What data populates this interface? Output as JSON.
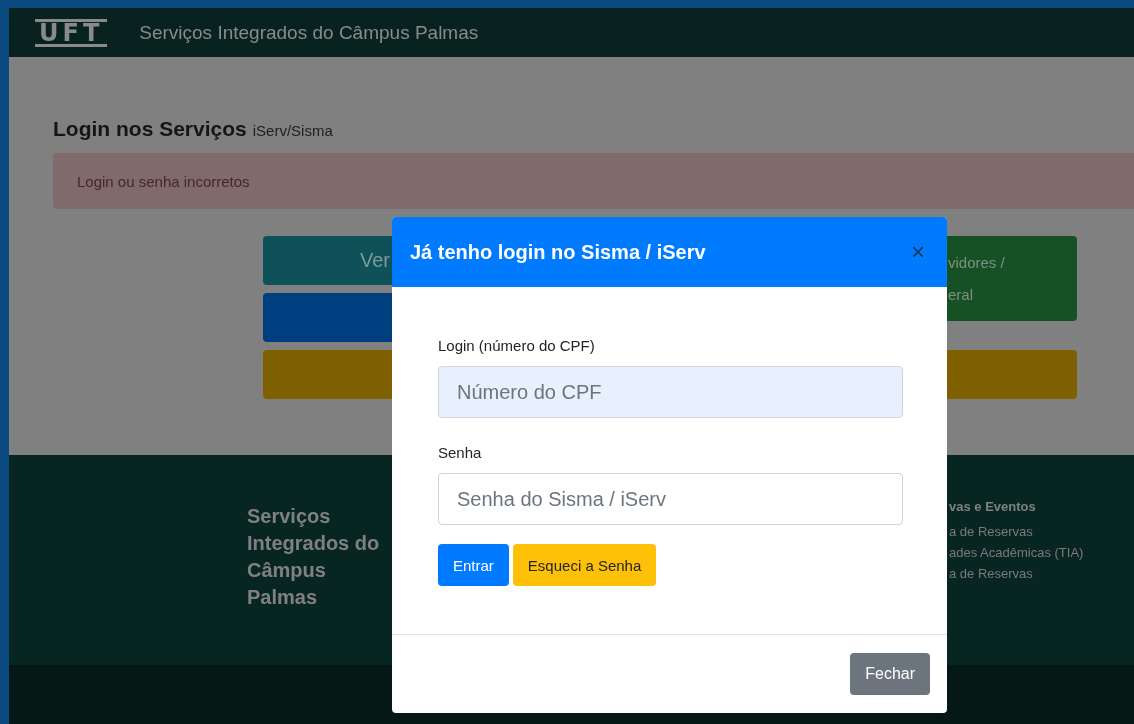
{
  "header": {
    "logo": "UFT",
    "title": "Serviços Integrados do Câmpus Palmas"
  },
  "login": {
    "heading": "Login nos Serviços",
    "subheading": "iServ/Sisma",
    "alert": "Login ou senha incorretos"
  },
  "service_buttons": [
    {
      "lines": [
        "Ver"
      ],
      "color": "#0e5158",
      "kind": "left"
    },
    {
      "lines": [
        "vidores /",
        "eral"
      ],
      "color": "#155124",
      "kind": "right"
    },
    {
      "color": "#003f7f",
      "kind": "left"
    },
    {
      "color": "#7f6000",
      "kind": "wide"
    }
  ],
  "footer": {
    "title": "Serviços Integrados do Câmpus Palmas",
    "column_heading": "vas e Eventos",
    "links": [
      "a de Reservas",
      "ades Acadêmicas (TIA)",
      "a de Reservas"
    ]
  },
  "modal": {
    "title": "Já tenho login no Sisma / iServ",
    "close": "×",
    "fields": [
      {
        "label": "Login (número do CPF)",
        "placeholder": "Número do CPF",
        "autofilled": true
      },
      {
        "label": "Senha",
        "placeholder": "Senha do Sisma / iServ",
        "autofilled": false
      }
    ],
    "actions": [
      {
        "label": "Entrar",
        "kind": "primary"
      },
      {
        "label": "Esqueci a Senha",
        "kind": "warning"
      }
    ],
    "footer_button": "Fechar"
  }
}
